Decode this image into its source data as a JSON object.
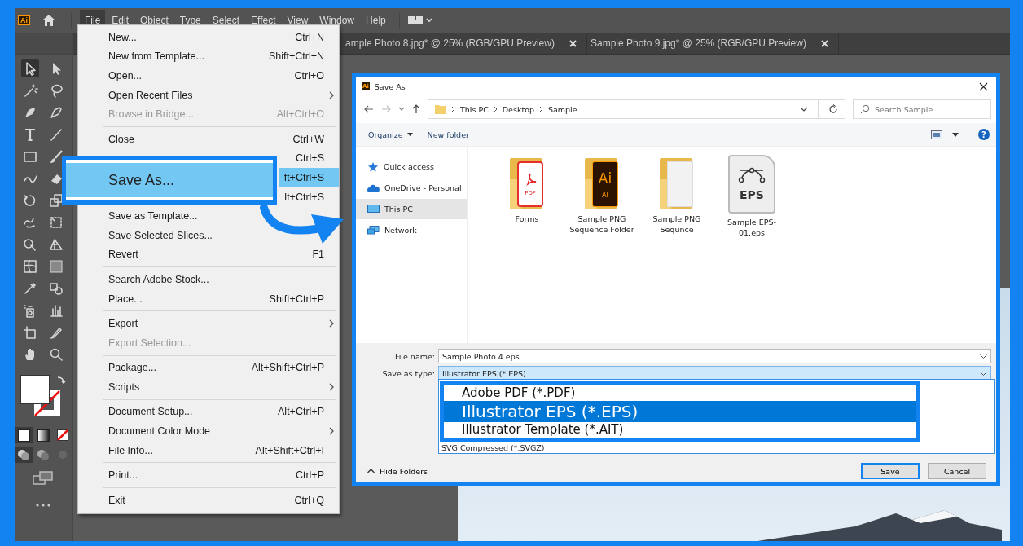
{
  "app": {
    "logo": "Ai",
    "menu": [
      {
        "label": "File",
        "selected": true
      },
      {
        "label": "Edit",
        "selected": false
      },
      {
        "label": "Object",
        "selected": false
      },
      {
        "label": "Type",
        "selected": false
      },
      {
        "label": "Select",
        "selected": false
      },
      {
        "label": "Effect",
        "selected": false
      },
      {
        "label": "View",
        "selected": false
      },
      {
        "label": "Window",
        "selected": false
      },
      {
        "label": "Help",
        "selected": false
      }
    ],
    "document_tabs": [
      {
        "title": "ample Photo 8.jpg* @ 25% (RGB/GPU Preview)"
      },
      {
        "title": "Sample Photo 9.jpg* @ 25% (RGB/GPU Preview)"
      }
    ]
  },
  "file_menu": {
    "items": [
      {
        "kind": "item",
        "label": "New...",
        "shortcut": "Ctrl+N",
        "disabled": false,
        "submenu": false,
        "selected": false
      },
      {
        "kind": "item",
        "label": "New from Template...",
        "shortcut": "Shift+Ctrl+N",
        "disabled": false,
        "submenu": false,
        "selected": false
      },
      {
        "kind": "item",
        "label": "Open...",
        "shortcut": "Ctrl+O",
        "disabled": false,
        "submenu": false,
        "selected": false
      },
      {
        "kind": "item",
        "label": "Open Recent Files",
        "disabled": false,
        "submenu": true,
        "selected": false
      },
      {
        "kind": "item",
        "label": "Browse in Bridge...",
        "shortcut": "Alt+Ctrl+O",
        "disabled": true,
        "submenu": false,
        "selected": false
      },
      {
        "kind": "separator"
      },
      {
        "kind": "item",
        "label": "Close",
        "shortcut": "Ctrl+W",
        "disabled": false,
        "submenu": false,
        "selected": false
      },
      {
        "kind": "item",
        "shortcut": "Ctrl+S",
        "disabled": false,
        "submenu": false,
        "selected": false
      },
      {
        "kind": "item",
        "shortcut": "ft+Ctrl+S",
        "disabled": false,
        "submenu": false,
        "selected": true
      },
      {
        "kind": "item",
        "shortcut": "lt+Ctrl+S",
        "disabled": false,
        "submenu": false,
        "selected": false
      },
      {
        "kind": "item",
        "label": "Save as Template...",
        "disabled": false,
        "submenu": false,
        "selected": false
      },
      {
        "kind": "item",
        "label": "Save Selected Slices...",
        "disabled": false,
        "submenu": false,
        "selected": false
      },
      {
        "kind": "item",
        "label": "Revert",
        "shortcut": "F1",
        "disabled": false,
        "submenu": false,
        "selected": false
      },
      {
        "kind": "separator"
      },
      {
        "kind": "item",
        "label": "Search Adobe Stock...",
        "disabled": false,
        "submenu": false,
        "selected": false
      },
      {
        "kind": "item",
        "label": "Place...",
        "shortcut": "Shift+Ctrl+P",
        "disabled": false,
        "submenu": false,
        "selected": false
      },
      {
        "kind": "separator"
      },
      {
        "kind": "item",
        "label": "Export",
        "disabled": false,
        "submenu": true,
        "selected": false
      },
      {
        "kind": "item",
        "label": "Export Selection...",
        "disabled": true,
        "submenu": false,
        "selected": false
      },
      {
        "kind": "separator"
      },
      {
        "kind": "item",
        "label": "Package...",
        "shortcut": "Alt+Shift+Ctrl+P",
        "disabled": false,
        "submenu": false,
        "selected": false
      },
      {
        "kind": "item",
        "label": "Scripts",
        "disabled": false,
        "submenu": true,
        "selected": false
      },
      {
        "kind": "separator"
      },
      {
        "kind": "item",
        "label": "Document Setup...",
        "shortcut": "Alt+Ctrl+P",
        "disabled": false,
        "submenu": false,
        "selected": false
      },
      {
        "kind": "item",
        "label": "Document Color Mode",
        "disabled": false,
        "submenu": true,
        "selected": false
      },
      {
        "kind": "item",
        "label": "File Info...",
        "shortcut": "Alt+Shift+Ctrl+I",
        "disabled": false,
        "submenu": false,
        "selected": false
      },
      {
        "kind": "separator"
      },
      {
        "kind": "item",
        "label": "Print...",
        "shortcut": "Ctrl+P",
        "disabled": false,
        "submenu": false,
        "selected": false
      },
      {
        "kind": "separator"
      },
      {
        "kind": "item",
        "label": "Exit",
        "shortcut": "Ctrl+Q",
        "disabled": false,
        "submenu": false,
        "selected": false
      }
    ]
  },
  "menu_callout": {
    "label": "Save As..."
  },
  "dialog": {
    "logo": "Ai",
    "title": "Save As",
    "breadcrumb": [
      "This PC",
      "Desktop",
      "Sample"
    ],
    "search": {
      "placeholder": "Search Sample"
    },
    "commands": [
      {
        "label": "Organize",
        "dropdown": true
      },
      {
        "label": "New folder",
        "dropdown": false
      }
    ],
    "help": "?",
    "nav": [
      {
        "label": "Quick access",
        "kind": "star",
        "selected": false
      },
      {
        "label": "OneDrive - Personal",
        "kind": "cloud",
        "selected": false
      },
      {
        "label": "This PC",
        "kind": "computer",
        "selected": true
      },
      {
        "label": "Network",
        "kind": "network",
        "selected": false
      }
    ],
    "files": [
      {
        "name": "Forms",
        "kind": "pdf-folder",
        "badge": "PDF"
      },
      {
        "name": "Sample PNG Sequence Folder",
        "kind": "ai-folder",
        "badge": "Ai",
        "sub_badge": "AI"
      },
      {
        "name": "Sample PNG Sequnce",
        "kind": "folder"
      },
      {
        "name": "Sample EPS-01.eps",
        "kind": "eps",
        "badge": "EPS"
      }
    ],
    "file_name": {
      "label": "File name:",
      "value": "Sample Photo 4.eps"
    },
    "save_type": {
      "label": "Save as type:",
      "value": "Illustrator EPS (*.EPS)",
      "options": [
        {
          "label": "SVG Compressed (*.SVGZ)"
        }
      ]
    },
    "hide_folders": "Hide Folders",
    "buttons": [
      {
        "label": "Save",
        "default": true
      },
      {
        "label": "Cancel",
        "default": false
      }
    ]
  },
  "type_callout": {
    "options": [
      {
        "label": "Adobe PDF (*.PDF)",
        "selected": false
      },
      {
        "label": "Illustrator EPS (*.EPS)",
        "selected": true
      },
      {
        "label": "Illustrator Template (*.AIT)",
        "selected": false
      }
    ]
  }
}
